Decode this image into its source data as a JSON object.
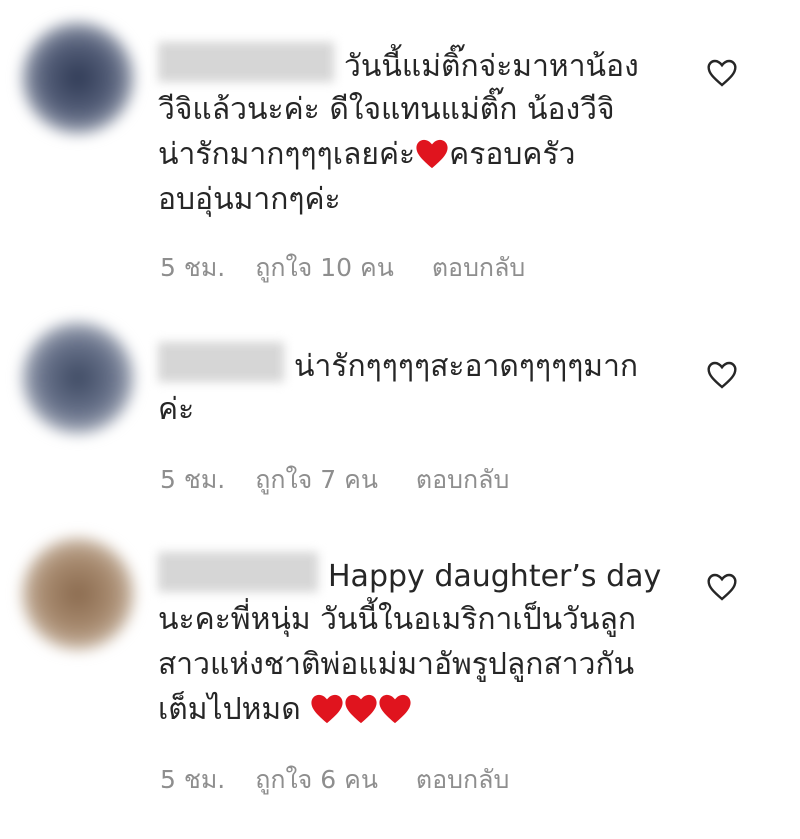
{
  "colors": {
    "text": "#262626",
    "meta": "#8e8e8e",
    "heart_emoji": "#e0141e",
    "like_outline": "#262626"
  },
  "comments": [
    {
      "avatar_color": "#3a4660",
      "lines": [
        "วันนี้แม่ติ๊กจ่ะมาหาน้อง",
        "วีจิแล้วนะค่ะ ดีใจแทนแม่ติ๊ก น้องวีจิ",
        "น่ารักมากๆๆๆเลยค่ะ",
        "อบอุ่นมากๆค่ะ"
      ],
      "line3_after_emoji": "ครอบครัว",
      "time": "5 ชม.",
      "likes": "ถูกใจ 10 คน",
      "reply_label": "ตอบกลับ",
      "like_icon": "heart-outline-icon"
    },
    {
      "avatar_color": "#4f5a70",
      "lines": [
        "น่ารักๆๆๆๆสะอาดๆๆๆๆมาก",
        "ค่ะ"
      ],
      "time": "5 ชม.",
      "likes": "ถูกใจ 7 คน",
      "reply_label": "ตอบกลับ",
      "like_icon": "heart-outline-icon"
    },
    {
      "avatar_color": "#9a7b5e",
      "lines": [
        "Happy daughter’s day",
        "นะคะพี่หนุ่ม วันนี้ในอเมริกาเป็นวันลูก",
        "สาวแห่งชาติพ่อแม่มาอัพรูปลูกสาวกัน",
        "เต็มไปหมด"
      ],
      "time": "5 ชม.",
      "likes": "ถูกใจ 6 คน",
      "reply_label": "ตอบกลับ",
      "like_icon": "heart-outline-icon"
    }
  ]
}
